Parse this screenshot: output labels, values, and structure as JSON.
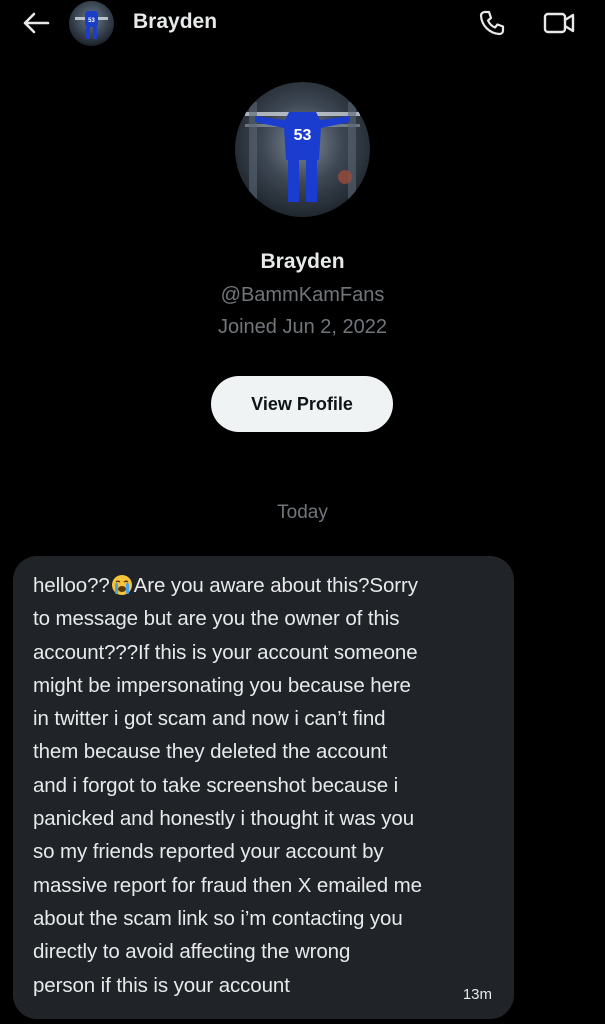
{
  "header": {
    "name": "Brayden"
  },
  "profile": {
    "name": "Brayden",
    "handle": "@BammKamFans",
    "joined": "Joined Jun 2, 2022",
    "view_profile_label": "View Profile",
    "jersey_number": "53"
  },
  "conversation": {
    "day_label": "Today",
    "message": {
      "text_before_emoji": "helloo??",
      "emoji": "loudly-crying-face",
      "line1_rest": "Are you aware about this?Sorry",
      "lines": [
        "to message but are you the owner of this",
        "account???If this is your account someone",
        "might be impersonating you because here",
        "in twitter i got scam and now i can’t find",
        "them because they deleted the account",
        "and i forgot to take screenshot because i",
        "panicked and honestly i thought it was you",
        "so my friends reported your account by",
        "massive report for fraud then X emailed me",
        "about the scam link so i’m contacting you",
        "directly to avoid affecting the wrong",
        "person if this is your account"
      ],
      "time": "13m"
    }
  },
  "icons": {
    "back": "arrow-left-icon",
    "call": "phone-icon",
    "video": "video-camera-icon"
  },
  "colors": {
    "background": "#000000",
    "bubble": "#202327",
    "secondary_text": "#71767b",
    "button_bg": "#eff3f4"
  }
}
